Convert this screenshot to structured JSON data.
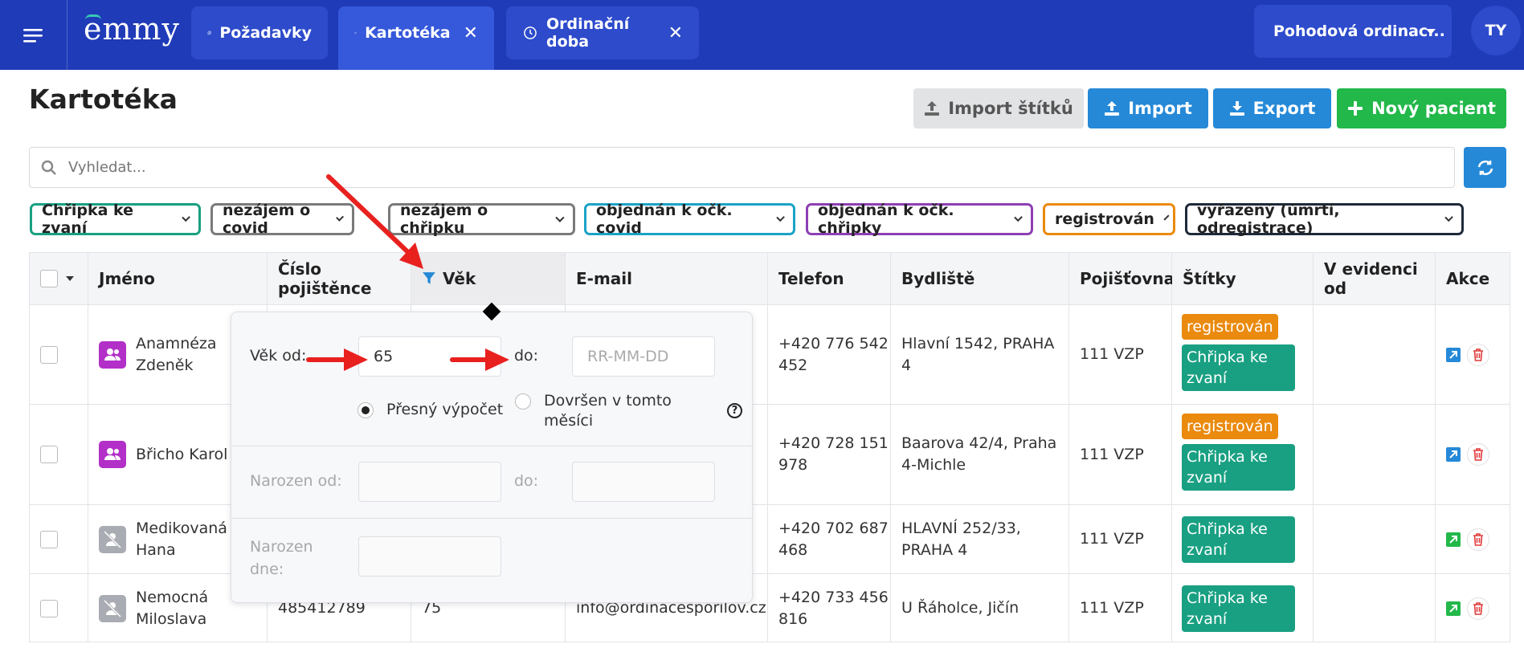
{
  "app": {
    "logo": "emmy",
    "user_initials": "TY",
    "clinic_name": "Pohodová ordinac..."
  },
  "tabs": [
    {
      "label": "Požadavky",
      "closable": false,
      "active": false
    },
    {
      "label": "Kartotéka",
      "closable": true,
      "active": true
    },
    {
      "label": "Ordinační doba",
      "closable": true,
      "active": false
    }
  ],
  "tab_close_glyph": "✕",
  "page": {
    "title": "Kartotéka"
  },
  "actions": {
    "import_tags": "Import štítků",
    "import": "Import",
    "export": "Export",
    "new_patient": "Nový pacient"
  },
  "search": {
    "placeholder": "Vyhledat..."
  },
  "filters": [
    {
      "label": "Chřipka ke zvaní",
      "color": "#19a082"
    },
    {
      "label": "nezájem o covid",
      "color": "#7a7a7a"
    },
    {
      "label": "nezájem o chřipku",
      "color": "#7a7a7a"
    },
    {
      "label": "objednán k očk. covid",
      "color": "#1ba3c6"
    },
    {
      "label": "objednán k očk. chřipky",
      "color": "#8e3fb4"
    },
    {
      "label": "registrován",
      "color": "#ea8a0e"
    },
    {
      "label": "vyřazený (úmrtí, odregistrace)",
      "color": "#1e2a3a"
    }
  ],
  "table": {
    "columns": [
      "Jméno",
      "Číslo pojištěnce",
      "Věk",
      "E-mail",
      "Telefon",
      "Bydliště",
      "Pojišťovna",
      "Štítky",
      "V evidenci od",
      "Akce"
    ],
    "rows": [
      {
        "name": "Anamnéza Zdeněk",
        "insurance_no": "",
        "age": "",
        "email": "",
        "phone": "+420 776 542 452",
        "address": "Hlavní 1542, PRAHA 4",
        "insurer": "111 VZP",
        "tags": [
          "registrován",
          "Chřipka ke zvaní"
        ],
        "since": "",
        "registered": true
      },
      {
        "name": "Břicho Karol",
        "insurance_no": "",
        "age": "",
        "email": "",
        "phone": "+420 728 151 978",
        "address": "Baarova 42/4, Praha 4-Michle",
        "insurer": "111 VZP",
        "tags": [
          "registrován",
          "Chřipka ke zvaní"
        ],
        "since": "",
        "registered": true
      },
      {
        "name": "Medikovaná Hana",
        "insurance_no": "",
        "age": "",
        "email": "",
        "phone": "+420 702 687 468",
        "address": "HLAVNÍ 252/33, PRAHA 4",
        "insurer": "111 VZP",
        "tags": [
          "Chřipka ke zvaní"
        ],
        "since": "",
        "registered": false
      },
      {
        "name": "Nemocná Miloslava",
        "insurance_no": "485412789",
        "age": "75",
        "email": "info@ordinacesporilov.cz",
        "phone": "+420 733 456 816",
        "address": "U Řáholce, Jičín",
        "insurer": "111 VZP",
        "tags": [
          "Chřipka ke zvaní"
        ],
        "since": "",
        "registered": false
      }
    ]
  },
  "age_filter": {
    "age_from_label": "Věk od:",
    "age_from_value": "65",
    "to_label": "do:",
    "age_to_placeholder": "RR-MM-DD",
    "exact_label": "Přesný výpočet",
    "month_label_line1": "Dovršen v tomto",
    "month_label_line2": "měsíci",
    "born_from_label": "Narozen od:",
    "born_to_label": "do:",
    "born_on_label_line1": "Narozen",
    "born_on_label_line2": "dne:",
    "help_glyph": "?"
  },
  "colors": {
    "topbar": "#1f3bb8",
    "tab": "#2d4bcb",
    "primary": "#2589d8",
    "success": "#22b84a",
    "tag_orange": "#ea8a0e",
    "tag_green": "#19a082",
    "purple": "#b22fc8",
    "annotation": "#e8211f"
  }
}
